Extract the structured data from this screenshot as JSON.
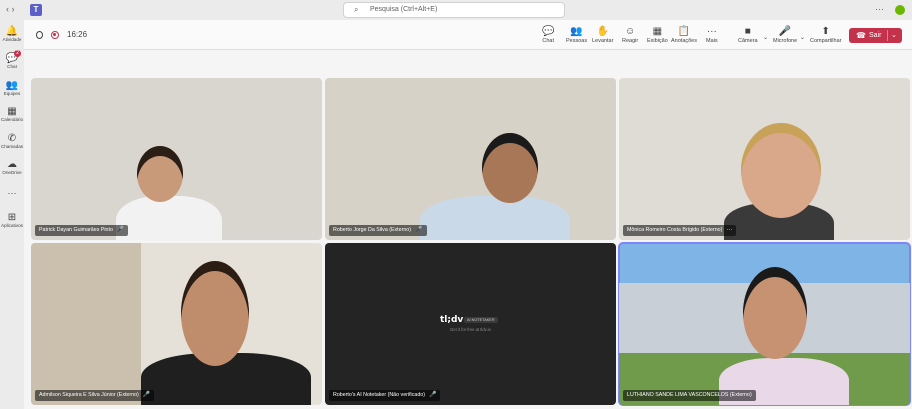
{
  "app": {
    "logo_letter": "T"
  },
  "search": {
    "placeholder": "Pesquisa (Ctrl+Alt+E)"
  },
  "titlebar": {
    "more": "···",
    "nav": "‹ ›"
  },
  "rail": {
    "items": [
      {
        "label": "Atividade",
        "icon": "bell-icon",
        "glyph": "🔔"
      },
      {
        "label": "Chat",
        "icon": "chat-icon",
        "glyph": "💬",
        "badge": "2"
      },
      {
        "label": "Equipes",
        "icon": "teams-icon",
        "glyph": "👥"
      },
      {
        "label": "Calendário",
        "icon": "calendar-icon",
        "glyph": "▦"
      },
      {
        "label": "Chamadas",
        "icon": "phone-icon",
        "glyph": "✆"
      },
      {
        "label": "OneDrive",
        "icon": "cloud-icon",
        "glyph": "☁"
      },
      {
        "label": "···",
        "icon": "more-icon",
        "glyph": ""
      },
      {
        "label": "Aplicativos",
        "icon": "apps-icon",
        "glyph": "⊞"
      }
    ]
  },
  "meeting": {
    "timer": "16:26",
    "controls": [
      {
        "label": "Chat",
        "glyph": "💬"
      },
      {
        "label": "Pessoas",
        "glyph": "👥"
      },
      {
        "label": "Levantar",
        "glyph": "✋"
      },
      {
        "label": "Reagir",
        "glyph": "☺"
      },
      {
        "label": "Exibição",
        "glyph": "▦"
      },
      {
        "label": "Anotações",
        "glyph": "📋"
      },
      {
        "label": "Mais",
        "glyph": "···"
      },
      {
        "label": "Câmera",
        "glyph": "■"
      },
      {
        "label": "Microfone",
        "glyph": "🎤"
      },
      {
        "label": "Compartilhar",
        "glyph": "⬆"
      }
    ],
    "leave_label": "Sair"
  },
  "participants": [
    {
      "name": "Patrick Dayan Guimarães Pinto",
      "bg": "#d9d6d0",
      "skin": "#c99a7a",
      "shirt": "#f2f2f2",
      "hair": "#2a1e17"
    },
    {
      "name": "Roberto Jorge Da Silva (Externo)",
      "bg": "#d7d2c8",
      "skin": "#a87758",
      "shirt": "#c9d9e8",
      "hair": "#1a1a1a"
    },
    {
      "name": "Mônica Romeiro Costa Brígido (Externo)",
      "bg": "#dedcd4",
      "skin": "#d9a88a",
      "shirt": "#3a3a3a",
      "hair": "#c9a25a",
      "more": "···"
    },
    {
      "name": "Admilson Siqueira E Silva Júnior (Externo)",
      "bg": "#e6e1d8",
      "skin": "#c08d6c",
      "shirt": "#1f1f1f",
      "hair": "#2b1d14"
    },
    {
      "name": "Roberto's AI Notetaker (Não verificado)",
      "bg": "#242424"
    },
    {
      "name": "LUTHIANO SANDE LIMA VASCONCELOS (Externo)",
      "bg": "#7eb4e6",
      "skin": "#c69272",
      "shirt": "#e8d8e8",
      "hair": "#1a1a1a"
    }
  ],
  "notetaker": {
    "logo": "tl;dv",
    "pill": "AI NOTETAKER",
    "sub": "Get it for free at tldv.io"
  }
}
